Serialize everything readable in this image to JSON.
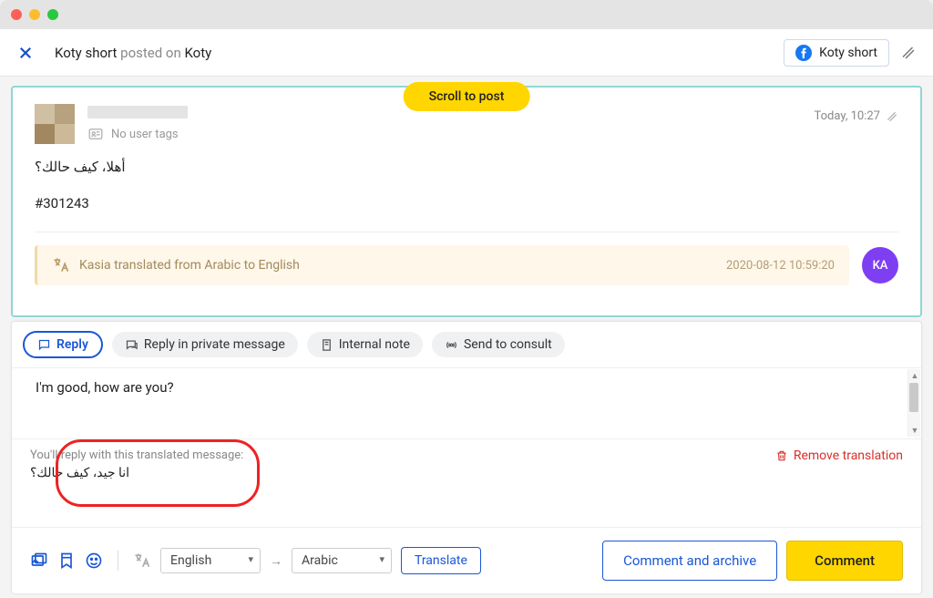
{
  "titlebar": {},
  "topbar": {
    "breadcrumb_strong": "Koty short",
    "breadcrumb_mid": " posted on ",
    "breadcrumb_end": "Koty",
    "fb_label": "Koty short"
  },
  "scroll_pill": "Scroll to post",
  "post": {
    "timestamp": "Today, 10:27",
    "no_tags": "No user tags",
    "body_ar": "أهلا، كيف حالك؟",
    "ref": "#301243"
  },
  "translation_event": {
    "text": "Kasia translated from Arabic to English",
    "time": "2020-08-12 10:59:20",
    "initials": "KA"
  },
  "tabs": {
    "reply": "Reply",
    "private": "Reply in private message",
    "internal": "Internal note",
    "consult": "Send to consult"
  },
  "editor": {
    "value": "I'm good, how are you?"
  },
  "preview": {
    "label": "You'll reply with this translated message:",
    "arabic": "انا جيد، كيف حالك؟",
    "remove": "Remove translation"
  },
  "footer": {
    "lang_from": "English",
    "lang_to": "Arabic",
    "translate": "Translate",
    "comment_archive": "Comment and archive",
    "comment": "Comment"
  }
}
